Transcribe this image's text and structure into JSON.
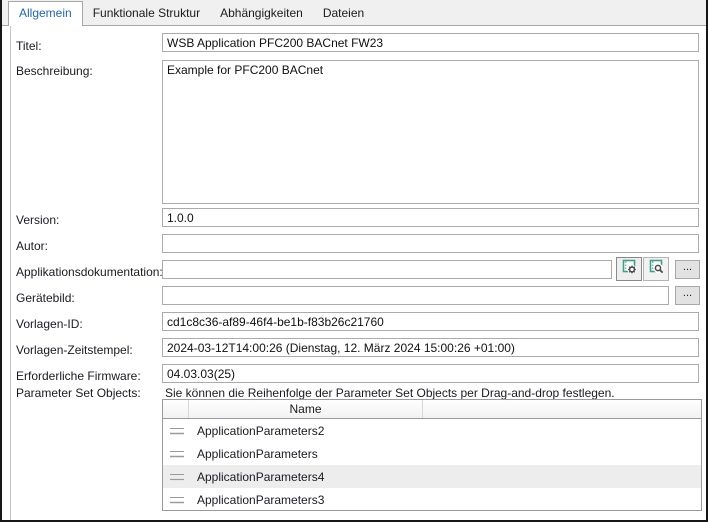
{
  "tabs": {
    "items": [
      {
        "label": "Allgemein"
      },
      {
        "label": "Funktionale Struktur"
      },
      {
        "label": "Abhängigkeiten"
      },
      {
        "label": "Dateien"
      }
    ],
    "active": "Allgemein"
  },
  "form": {
    "titel": {
      "label": "Titel:",
      "value": "WSB Application PFC200 BACnet FW23"
    },
    "beschreibung": {
      "label": "Beschreibung:",
      "value": "Example for PFC200 BACnet"
    },
    "version": {
      "label": "Version:",
      "value": "1.0.0"
    },
    "autor": {
      "label": "Autor:",
      "value": ""
    },
    "applikationsdokumentation": {
      "label": "Applikationsdokumentation:",
      "value": ""
    },
    "geraetebild": {
      "label": "Gerätebild:",
      "value": ""
    },
    "vorlagen_id": {
      "label": "Vorlagen-ID:",
      "value": "cd1c8c36-af89-46f4-be1b-f83b26c21760"
    },
    "vorlagen_zeitstempel": {
      "label": "Vorlagen-Zeitstempel:",
      "value": "2024-03-12T14:00:26 (Dienstag, 12. März 2024 15:00:26 +01:00)"
    },
    "erforderliche_firmware": {
      "label": "Erforderliche Firmware:",
      "value": "04.03.03(25)"
    },
    "parameter_set_objects": {
      "label": "Parameter Set Objects:",
      "hint": "Sie können die Reihenfolge der Parameter Set Objects per Drag-and-drop festlegen."
    }
  },
  "buttons": {
    "browse_label": "...",
    "icons": {
      "edit_document": "document-gear-icon",
      "preview_document": "document-magnifier-icon"
    }
  },
  "table": {
    "header": {
      "name": "Name"
    },
    "rows": [
      {
        "name": "ApplicationParameters2"
      },
      {
        "name": "ApplicationParameters"
      },
      {
        "name": "ApplicationParameters4"
      },
      {
        "name": "ApplicationParameters3"
      }
    ],
    "selected_index": 2,
    "selected_row": "ApplicationParameters4"
  },
  "colors": {
    "active_tab_text": "#1f66b0",
    "icon_teal": "#3ba188",
    "selected_row_bg": "#ededed",
    "outer_border": "#161616",
    "input_border": "#ababab"
  }
}
